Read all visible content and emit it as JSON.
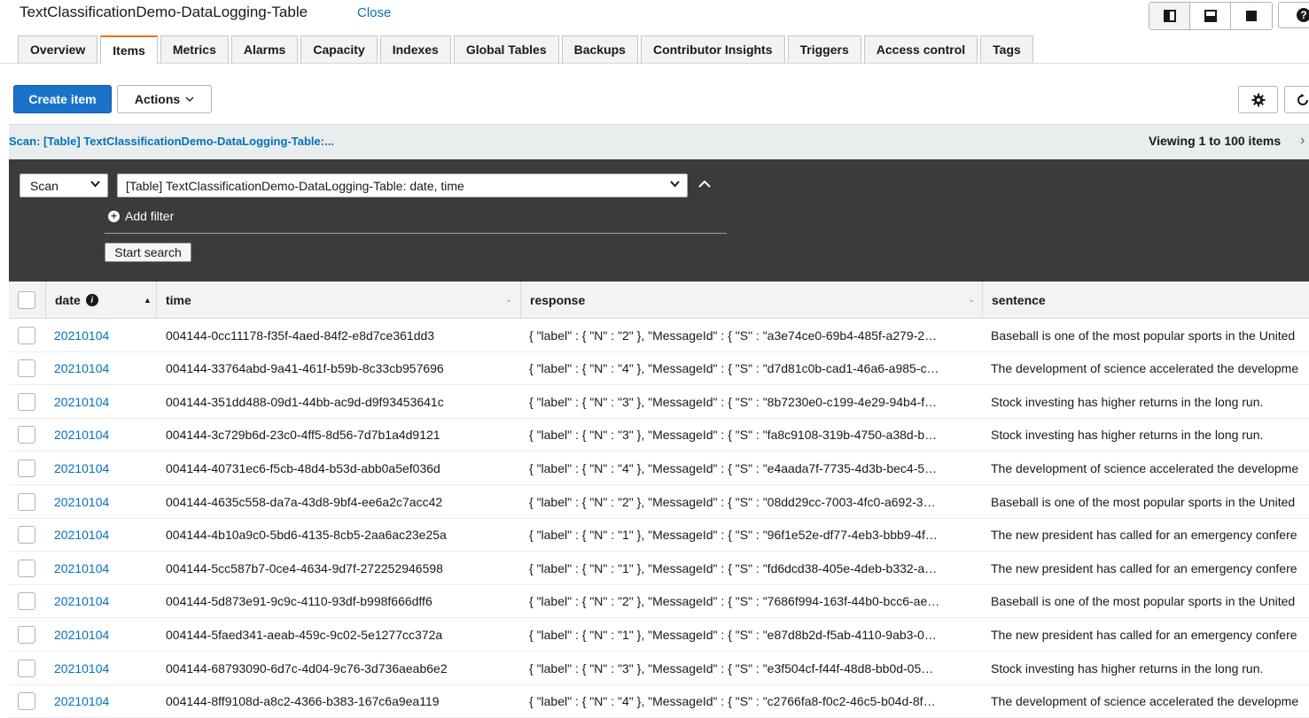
{
  "header": {
    "table_name": "TextClassificationDemo-DataLogging-Table",
    "close_label": "Close"
  },
  "tabs": [
    "Overview",
    "Items",
    "Metrics",
    "Alarms",
    "Capacity",
    "Indexes",
    "Global Tables",
    "Backups",
    "Contributor Insights",
    "Triggers",
    "Access control",
    "Tags"
  ],
  "active_tab": "Items",
  "toolbar": {
    "create_label": "Create item",
    "actions_label": "Actions"
  },
  "scan_bar": {
    "title": "Scan: [Table] TextClassificationDemo-DataLogging-Table:...",
    "viewing": "Viewing 1 to 100 items"
  },
  "scan_panel": {
    "mode": "Scan",
    "target": "[Table] TextClassificationDemo-DataLogging-Table: date, time",
    "add_filter": "Add filter",
    "start_search": "Start search"
  },
  "columns": {
    "date": "date",
    "time": "time",
    "response": "response",
    "sentence": "sentence"
  },
  "rows": [
    {
      "date": "20210104",
      "time": "004144-0cc11178-f35f-4aed-84f2-e8d7ce361dd3",
      "response": "{ \"label\" : { \"N\" : \"2\" }, \"MessageId\" : { \"S\" : \"a3e74ce0-69b4-485f-a279-2…",
      "sentence": "Baseball is one of the most popular sports in the United"
    },
    {
      "date": "20210104",
      "time": "004144-33764abd-9a41-461f-b59b-8c33cb957696",
      "response": "{ \"label\" : { \"N\" : \"4\" }, \"MessageId\" : { \"S\" : \"d7d81c0b-cad1-46a6-a985-c…",
      "sentence": "The development of science accelerated the developme"
    },
    {
      "date": "20210104",
      "time": "004144-351dd488-09d1-44bb-ac9d-d9f93453641c",
      "response": "{ \"label\" : { \"N\" : \"3\" }, \"MessageId\" : { \"S\" : \"8b7230e0-c199-4e29-94b4-f…",
      "sentence": "Stock investing has higher returns in the long run."
    },
    {
      "date": "20210104",
      "time": "004144-3c729b6d-23c0-4ff5-8d56-7d7b1a4d9121",
      "response": "{ \"label\" : { \"N\" : \"3\" }, \"MessageId\" : { \"S\" : \"fa8c9108-319b-4750-a38d-b…",
      "sentence": "Stock investing has higher returns in the long run."
    },
    {
      "date": "20210104",
      "time": "004144-40731ec6-f5cb-48d4-b53d-abb0a5ef036d",
      "response": "{ \"label\" : { \"N\" : \"4\" }, \"MessageId\" : { \"S\" : \"e4aada7f-7735-4d3b-bec4-5…",
      "sentence": "The development of science accelerated the developme"
    },
    {
      "date": "20210104",
      "time": "004144-4635c558-da7a-43d8-9bf4-ee6a2c7acc42",
      "response": "{ \"label\" : { \"N\" : \"2\" }, \"MessageId\" : { \"S\" : \"08dd29cc-7003-4fc0-a692-3…",
      "sentence": "Baseball is one of the most popular sports in the United"
    },
    {
      "date": "20210104",
      "time": "004144-4b10a9c0-5bd6-4135-8cb5-2aa6ac23e25a",
      "response": "{ \"label\" : { \"N\" : \"1\" }, \"MessageId\" : { \"S\" : \"96f1e52e-df77-4eb3-bbb9-4f…",
      "sentence": "The new president has called for an emergency confere"
    },
    {
      "date": "20210104",
      "time": "004144-5cc587b7-0ce4-4634-9d7f-272252946598",
      "response": "{ \"label\" : { \"N\" : \"1\" }, \"MessageId\" : { \"S\" : \"fd6dcd38-405e-4deb-b332-a…",
      "sentence": "The new president has called for an emergency confere"
    },
    {
      "date": "20210104",
      "time": "004144-5d873e91-9c9c-4110-93df-b998f666dff6",
      "response": "{ \"label\" : { \"N\" : \"2\" }, \"MessageId\" : { \"S\" : \"7686f994-163f-44b0-bcc6-ae…",
      "sentence": "Baseball is one of the most popular sports in the United"
    },
    {
      "date": "20210104",
      "time": "004144-5faed341-aeab-459c-9c02-5e1277cc372a",
      "response": "{ \"label\" : { \"N\" : \"1\" }, \"MessageId\" : { \"S\" : \"e87d8b2d-f5ab-4110-9ab3-0…",
      "sentence": "The new president has called for an emergency confere"
    },
    {
      "date": "20210104",
      "time": "004144-68793090-6d7c-4d04-9c76-3d736aeab6e2",
      "response": "{ \"label\" : { \"N\" : \"3\" }, \"MessageId\" : { \"S\" : \"e3f504cf-f44f-48d8-bb0d-05…",
      "sentence": "Stock investing has higher returns in the long run."
    },
    {
      "date": "20210104",
      "time": "004144-8ff9108d-a8c2-4366-b383-167c6a9ea119",
      "response": "{ \"label\" : { \"N\" : \"4\" }, \"MessageId\" : { \"S\" : \"c2766fa8-f0c2-46c5-b04d-8f…",
      "sentence": "The development of science accelerated the developme"
    }
  ],
  "colors": {
    "primary_button": "#1a73c9",
    "link": "#0073bb",
    "active_tab_accent": "#ec7211",
    "scan_panel_bg": "#3b3b3b"
  }
}
